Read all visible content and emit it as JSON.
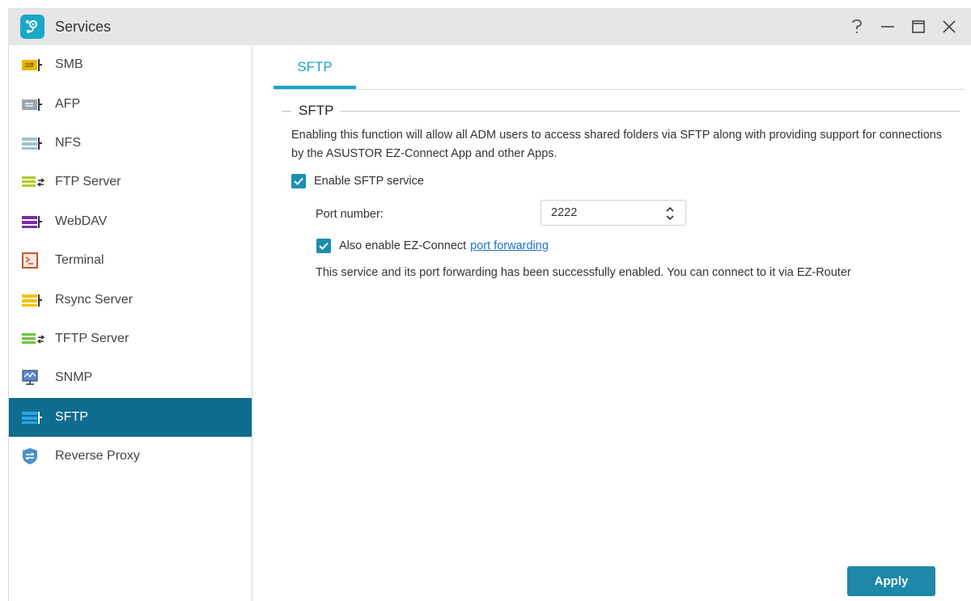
{
  "window": {
    "title": "Services",
    "app_icon": "services-app-icon",
    "controls": [
      "help-icon",
      "minimize-icon",
      "maximize-icon",
      "close-icon"
    ]
  },
  "sidebar": {
    "items": [
      {
        "label": "SMB",
        "icon": "smb-icon",
        "color": "#e8b800"
      },
      {
        "label": "AFP",
        "icon": "afp-icon",
        "color": "#9aa5ae"
      },
      {
        "label": "NFS",
        "icon": "nfs-icon",
        "color": "#9ec4c7"
      },
      {
        "label": "FTP Server",
        "icon": "ftp-server-icon",
        "color": "#b4c928"
      },
      {
        "label": "WebDAV",
        "icon": "webdav-icon",
        "color": "#7b2ba8"
      },
      {
        "label": "Terminal",
        "icon": "terminal-icon",
        "color": "#c0592b"
      },
      {
        "label": "Rsync Server",
        "icon": "rsync-server-icon",
        "color": "#f2c200"
      },
      {
        "label": "TFTP Server",
        "icon": "tftp-server-icon",
        "color": "#6cc43a"
      },
      {
        "label": "SNMP",
        "icon": "snmp-icon",
        "color": "#5b86c4"
      },
      {
        "label": "SFTP",
        "icon": "sftp-icon",
        "color": "#2aa3e6",
        "active": true
      },
      {
        "label": "Reverse Proxy",
        "icon": "reverse-proxy-icon",
        "color": "#4a90c8"
      }
    ]
  },
  "tabs": [
    {
      "label": "SFTP",
      "active": true
    }
  ],
  "section": {
    "title": "SFTP",
    "description": "Enabling this function will allow all ADM users to access shared folders via SFTP along with providing support for connections by the ASUSTOR EZ-Connect App and other Apps.",
    "enable_label": "Enable SFTP service",
    "enable_checked": true,
    "port_label": "Port number:",
    "port_value": "2222",
    "ezconnect_label": "Also enable EZ-Connect",
    "ezconnect_link": "port forwarding",
    "ezconnect_checked": true,
    "status_text": "This service and its port forwarding has been successfully enabled. You can connect to it via EZ-Router"
  },
  "apply_label": "Apply",
  "colors": {
    "accent": "#17a4c4",
    "active_nav": "#0e6c8f",
    "apply": "#1e88a8",
    "link": "#1a73c8"
  }
}
